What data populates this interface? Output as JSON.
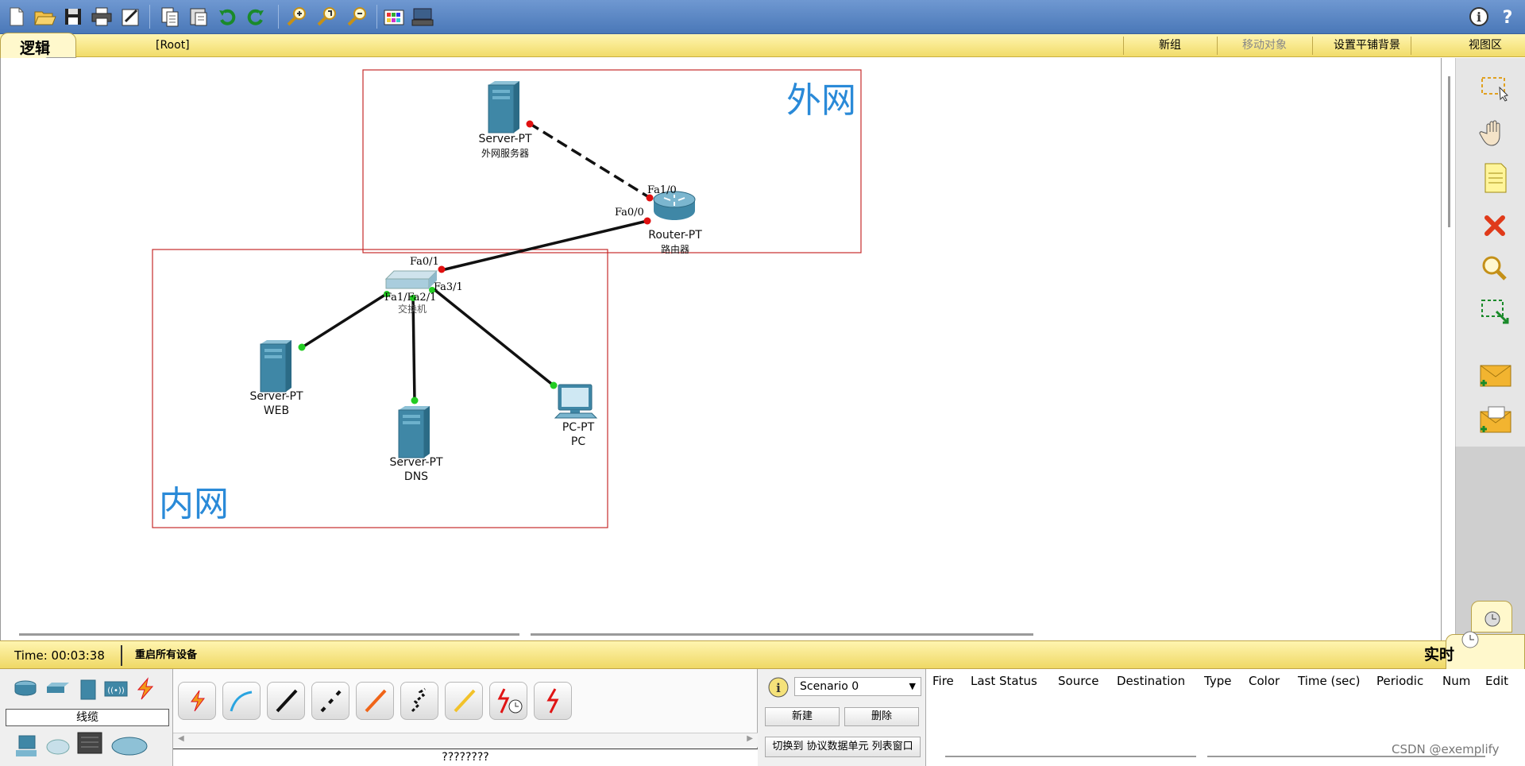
{
  "toolbar": {
    "buttons": [
      "new-icon",
      "open-icon",
      "save-icon",
      "print-icon",
      "wizard-icon",
      "copy-icon",
      "paste-icon",
      "undo-icon",
      "redo-icon",
      "zoom-in-icon",
      "zoom-reset-icon",
      "zoom-out-icon",
      "palette-icon",
      "custom-device-icon"
    ],
    "help": [
      "info-icon",
      "help-icon"
    ]
  },
  "modebar": {
    "tab": "逻辑",
    "path": "[Root]",
    "new_cluster": "新组",
    "move_object": "移动对象",
    "set_background": "设置平铺背景",
    "viewport": "视图区"
  },
  "network": {
    "zones": [
      {
        "label": "外网"
      },
      {
        "label": "内网"
      }
    ],
    "devices": {
      "outer_server": {
        "type": "Server-PT",
        "name": "外网服务器"
      },
      "router": {
        "type": "Router-PT",
        "name": "路由器"
      },
      "switch": {
        "type": "",
        "name": "交换机"
      },
      "web_server": {
        "type": "Server-PT",
        "name": "WEB"
      },
      "dns_server": {
        "type": "Server-PT",
        "name": "DNS"
      },
      "pc": {
        "type": "PC-PT",
        "name": "PC"
      }
    },
    "ports": {
      "router_fa10": "Fa1/0",
      "router_fa00": "Fa0/0",
      "switch_fa01": "Fa0/1",
      "switch_fa31": "Fa3/1",
      "switch_fa11_fa21": "Fa1/Fa2/1"
    },
    "link_colors": {
      "up": "#22cc22",
      "down": "#e01010"
    }
  },
  "right_palette": [
    "select-icon",
    "hand-icon",
    "note-icon",
    "delete-icon",
    "inspect-icon",
    "resize-icon",
    "simple-pdu-icon",
    "complex-pdu-icon"
  ],
  "status": {
    "time": "Time: 00:03:38",
    "power_cycle": "重启所有设备",
    "mode": "实时"
  },
  "device_categories": {
    "label": "线缆",
    "top_icons": [
      "router-category-icon",
      "switch-category-icon",
      "hub-category-icon",
      "wireless-category-icon",
      "connection-category-icon"
    ],
    "bottom_icons": [
      "end-device-icon",
      "cloud-icon",
      "custom-device-icon",
      "multiuser-icon"
    ]
  },
  "cables": {
    "items": [
      "auto-cable-icon",
      "console-cable-icon",
      "straight-cable-icon",
      "crossover-cable-icon",
      "fiber-cable-icon",
      "phone-cable-icon",
      "coaxial-cable-icon",
      "serial-dce-icon",
      "serial-dte-icon"
    ],
    "selected_label": "????????"
  },
  "scenario": {
    "selected": "Scenario 0",
    "new_button": "新建",
    "delete_button": "删除",
    "toggle_pdu": "切换到 协议数据单元 列表窗口"
  },
  "pdu_table": {
    "columns": [
      "Fire",
      "Last Status",
      "Source",
      "Destination",
      "Type",
      "Color",
      "Time (sec)",
      "Periodic",
      "Num",
      "Edit"
    ]
  },
  "watermark": "CSDN @exemplify"
}
